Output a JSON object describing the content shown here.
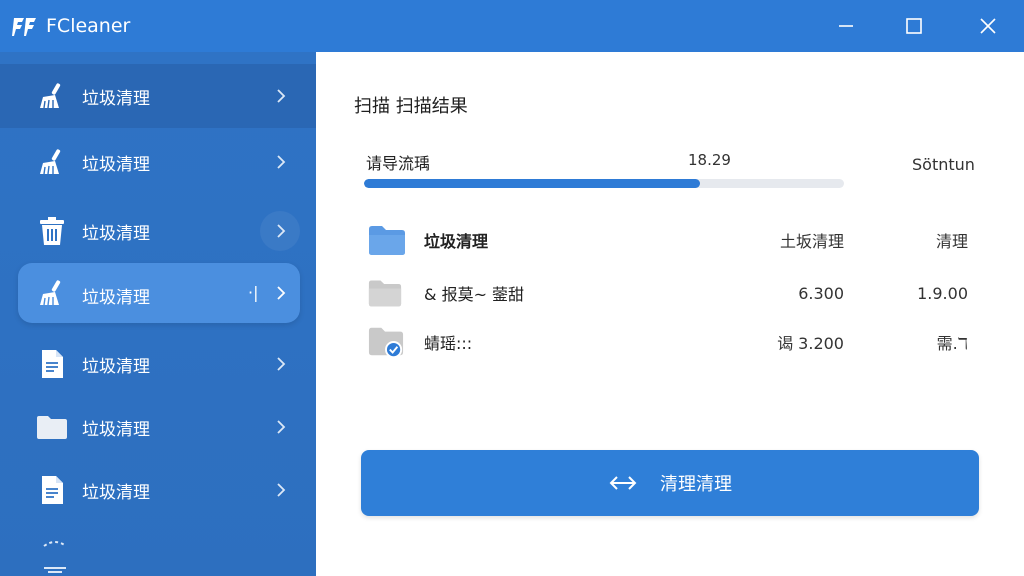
{
  "window": {
    "title": "FCleaner",
    "logo_icon": "fcleaner-logo-icon"
  },
  "sidebar": {
    "items": [
      {
        "label": "垃圾清理",
        "icon": "broom-icon"
      },
      {
        "label": "垃圾清理",
        "icon": "broom-icon"
      },
      {
        "label": "垃圾清理",
        "icon": "trash-icon"
      },
      {
        "label": "垃圾清理",
        "icon": "broom-icon",
        "extra": "·|"
      },
      {
        "label": "垃圾清理",
        "icon": "document-icon"
      },
      {
        "label": "垃圾清理",
        "icon": "folder-icon"
      },
      {
        "label": "垃圾清理",
        "icon": "document-icon"
      }
    ],
    "active_index": 3
  },
  "main": {
    "heading": "扫描  扫描结果",
    "progress": {
      "label": "请导流瑀",
      "value": "18.29",
      "right": "Sötntun",
      "fraction": 0.7
    },
    "rows": [
      {
        "name": "垃圾清理",
        "col1": "土坂清理",
        "col2": "清理",
        "icon": "folder-icon"
      },
      {
        "name": "& 报莫~ 蓥甜",
        "col1": "6.300",
        "col2": "1.9.00",
        "icon": "folder-icon"
      },
      {
        "name": "蜻瑶:::",
        "col1": "谒  3.200",
        "col2": "需.ℸ",
        "icon": "folder-check-icon"
      }
    ],
    "action_label": "清理清理"
  },
  "colors": {
    "accent": "#2e7bd6",
    "sidebar": "#2f73c5",
    "active": "#4b8fdf",
    "folder_blue": "#5b9ae4",
    "folder_gray": "#c9c9c9"
  }
}
